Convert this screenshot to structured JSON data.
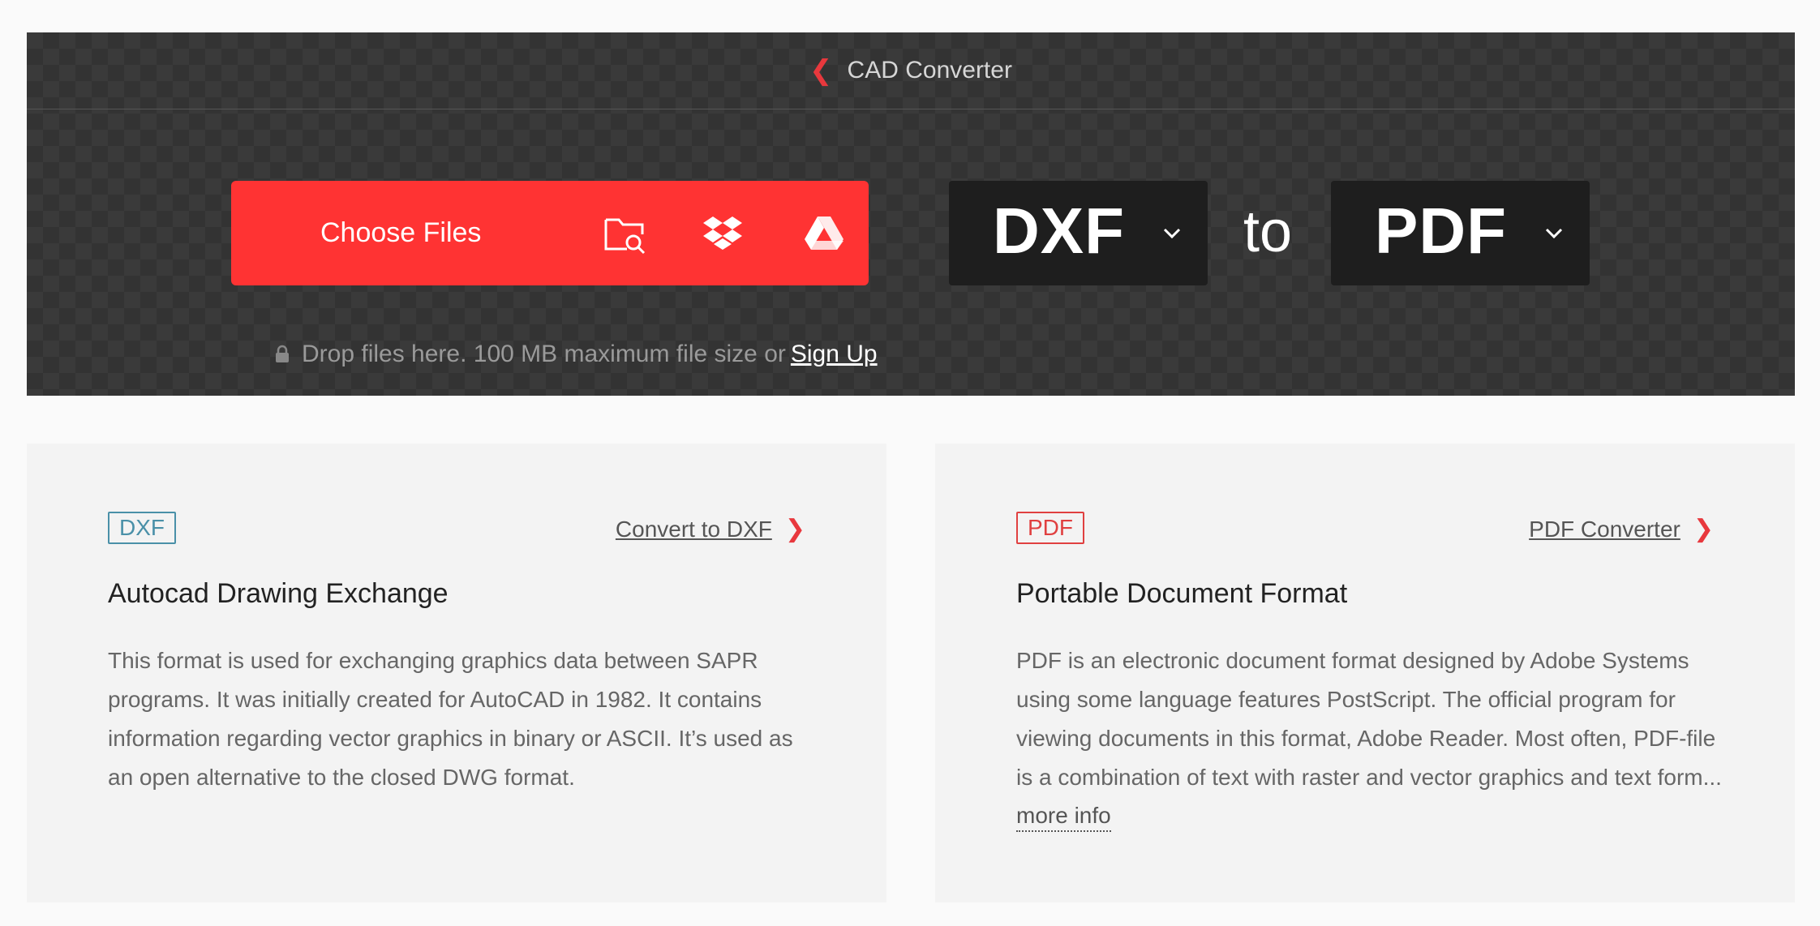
{
  "breadcrumb": {
    "label": "CAD Converter"
  },
  "upload": {
    "choose_label": "Choose Files",
    "drop_text": "Drop files here. 100 MB maximum file size or",
    "signup_label": "Sign Up"
  },
  "convert": {
    "from": "DXF",
    "connector": "to",
    "to": "PDF"
  },
  "cards": [
    {
      "badge": "DXF",
      "link": "Convert to DXF",
      "title": "Autocad Drawing Exchange",
      "description": "This format is used for exchanging graphics data between SAPR programs. It was initially created for AutoCAD in 1982. It contains information regarding vector graphics in binary or ASCII. It’s used as an open alternative to the closed DWG format."
    },
    {
      "badge": "PDF",
      "link": "PDF Converter",
      "title": "Portable Document Format",
      "description": "PDF is an electronic document format designed by Adobe Systems using some language features PostScript. The official program for viewing documents in this format, Adobe Reader. Most often, PDF-file is a combination of text with raster and vector graphics and text form...",
      "more": "more info"
    }
  ],
  "colors": {
    "accent": "#ff3333",
    "dxf_badge": "#4a90a8",
    "pdf_badge": "#e04040"
  }
}
